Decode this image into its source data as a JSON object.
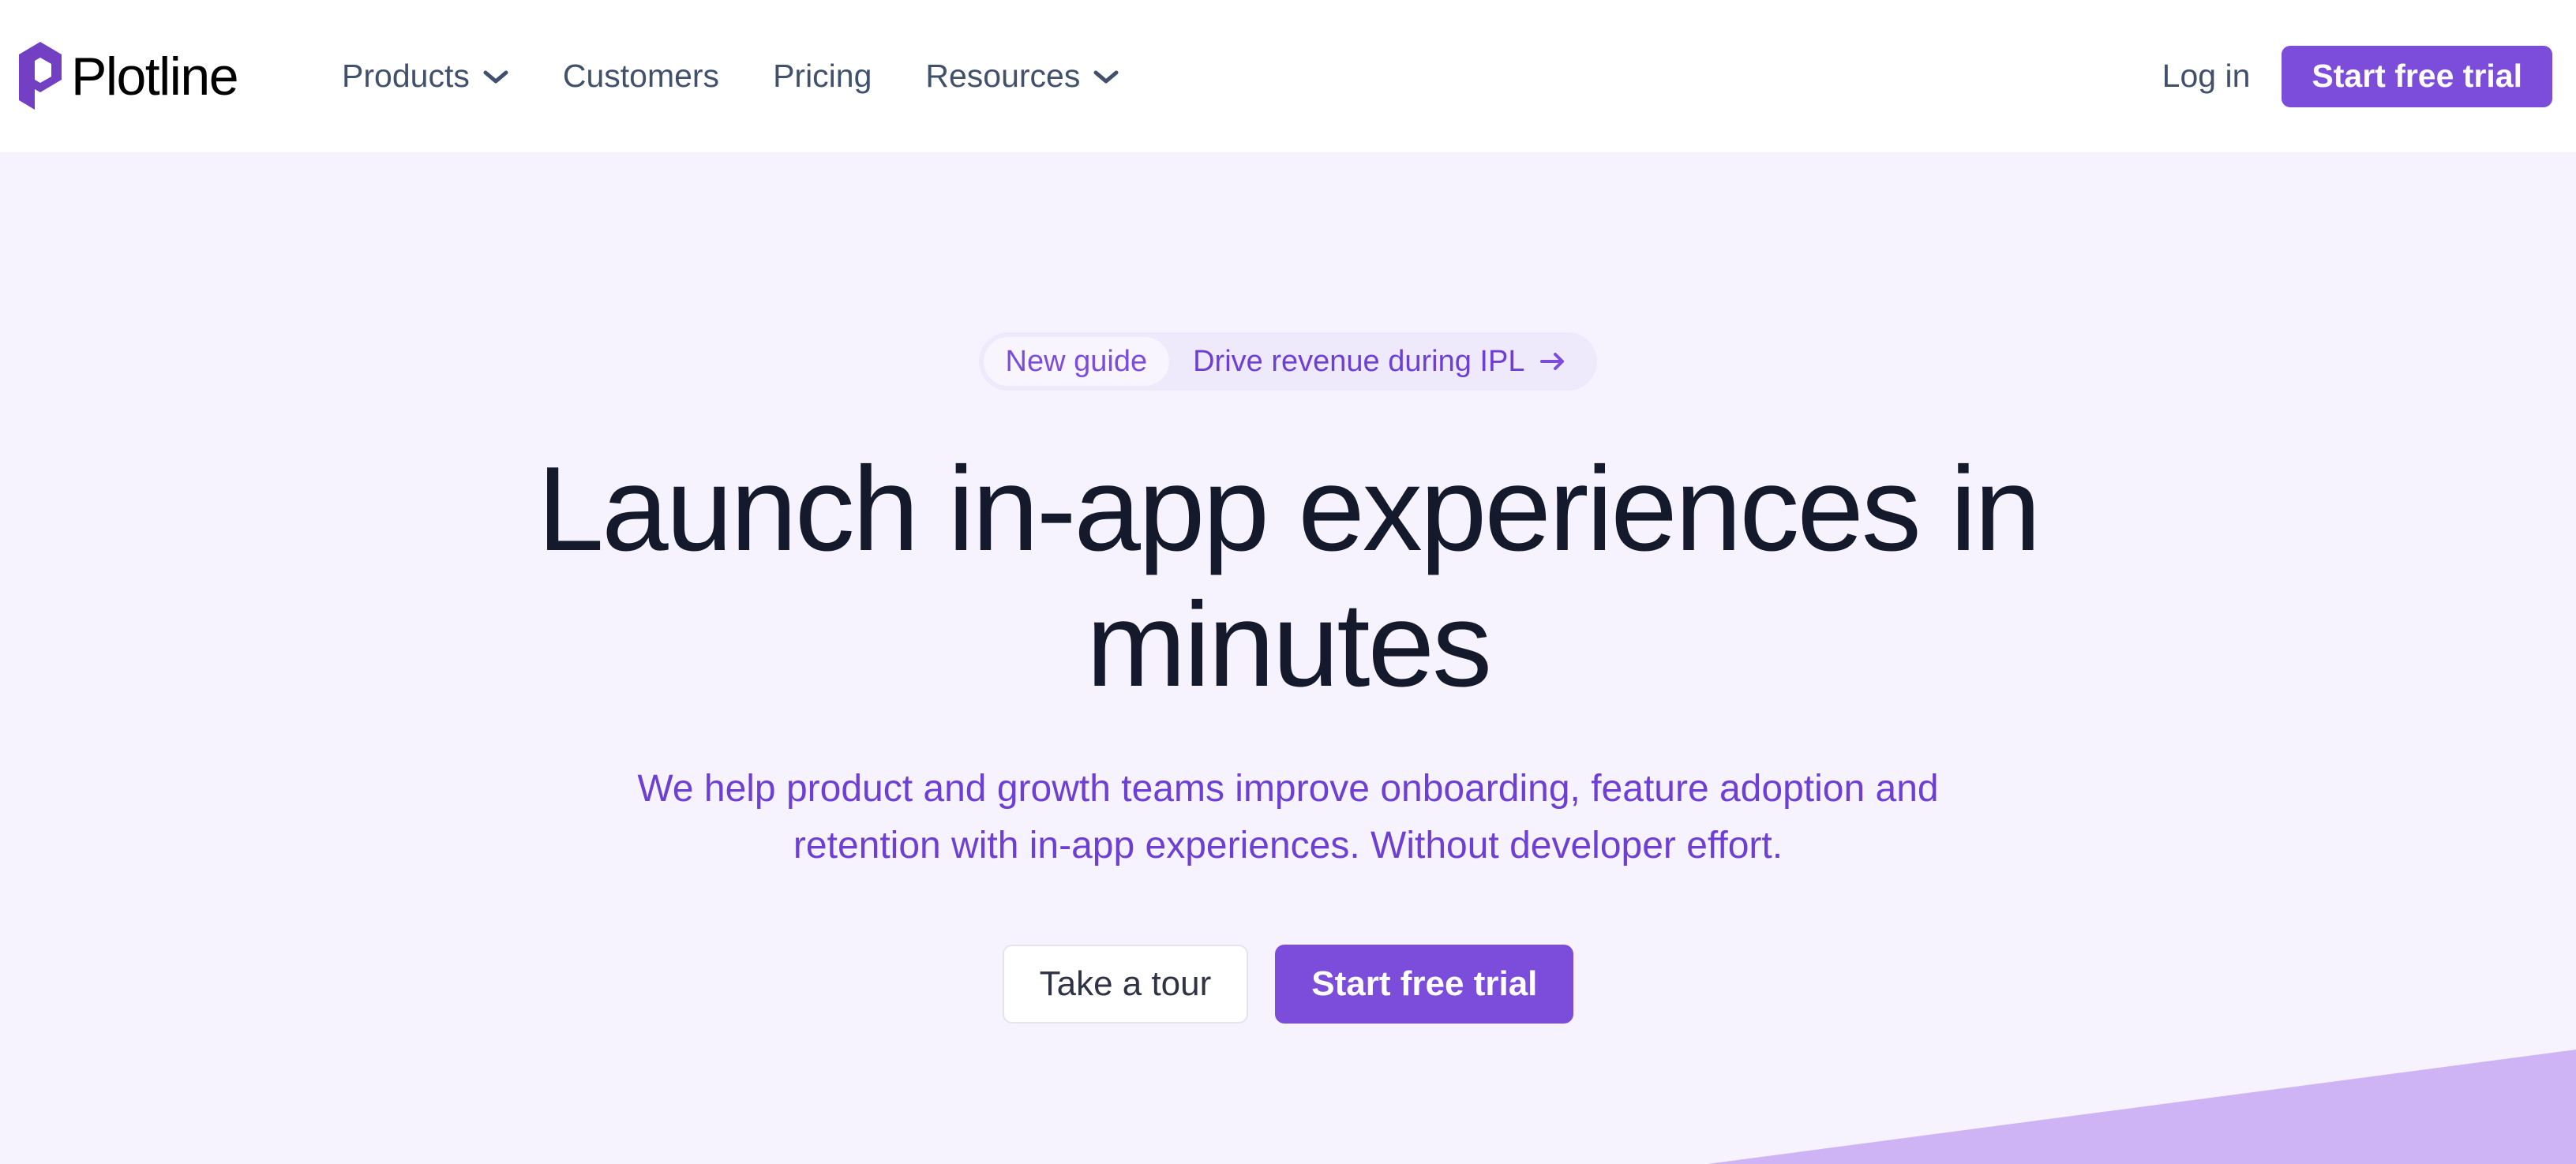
{
  "brand": {
    "name": "Plotline",
    "logo_icon": "plotline-hexagon-p-logo",
    "logo_color": "#7340c4"
  },
  "header": {
    "nav": [
      {
        "label": "Products",
        "has_dropdown": true,
        "icon": "chevron-down-icon"
      },
      {
        "label": "Customers",
        "has_dropdown": false,
        "icon": ""
      },
      {
        "label": "Pricing",
        "has_dropdown": false,
        "icon": ""
      },
      {
        "label": "Resources",
        "has_dropdown": true,
        "icon": "chevron-down-icon"
      }
    ],
    "login_label": "Log in",
    "trial_label": "Start free trial",
    "nav_text_color": "#41506b",
    "accent_color": "#7c4ddb"
  },
  "hero": {
    "background_color": "#f6f3fe",
    "announcement": {
      "badge_label": "New guide",
      "text": "Drive revenue during IPL",
      "arrow_icon": "arrow-right-icon",
      "badge_bg": "#f8f5ff",
      "pill_bg": "#eee9fb",
      "text_color": "#6d3fd4"
    },
    "headline": "Launch in-app experiences in minutes",
    "headline_color": "#141a2b",
    "subheading": "We help product and growth teams improve onboarding, feature adoption and retention with in-app experiences. Without developer effort.",
    "subheading_color": "#6d3fd4",
    "cta": {
      "secondary_label": "Take a tour",
      "primary_label": "Start free trial"
    },
    "decoration": {
      "shape": "diagonal-triangle",
      "color": "#ceb3f5"
    }
  }
}
